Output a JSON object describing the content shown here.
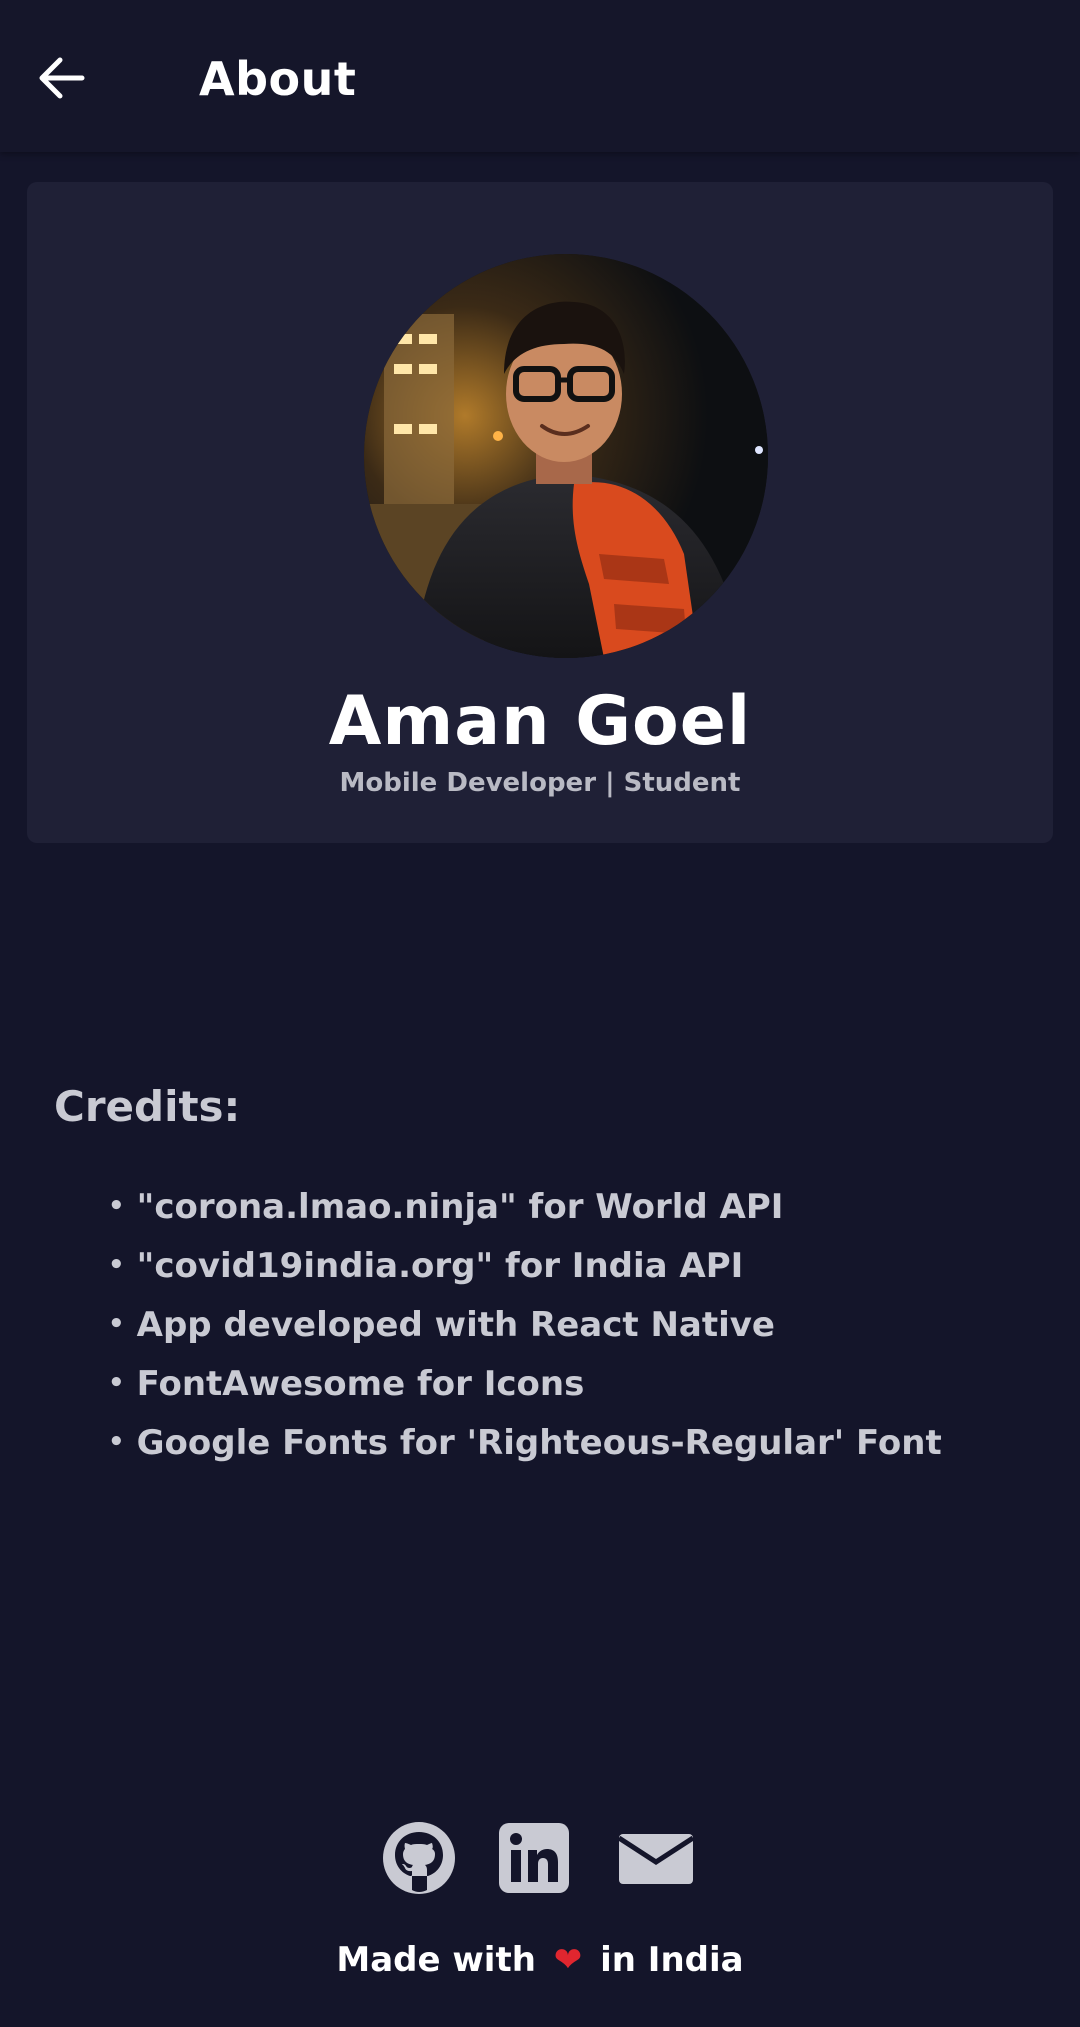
{
  "appbar": {
    "title": "About",
    "back_icon": "arrow-left-icon"
  },
  "profile": {
    "name": "Aman Goel",
    "role": "Mobile Developer | Student",
    "avatar": "profile-photo"
  },
  "credits": {
    "title": "Credits:",
    "items": [
      "\"corona.lmao.ninja\" for World API",
      "\"covid19india.org\" for India API",
      "App developed with React Native",
      "FontAwesome for Icons",
      "Google Fonts for 'Righteous-Regular' Font"
    ]
  },
  "social": {
    "icons": [
      "github-icon",
      "linkedin-icon",
      "mail-icon"
    ]
  },
  "footer": {
    "prefix": "Made with",
    "heart": "❤",
    "suffix": "in India",
    "heart_color": "#e0262f"
  },
  "colors": {
    "background": "#14152a",
    "card": "#1f2036",
    "text_muted": "#c9cad3"
  }
}
